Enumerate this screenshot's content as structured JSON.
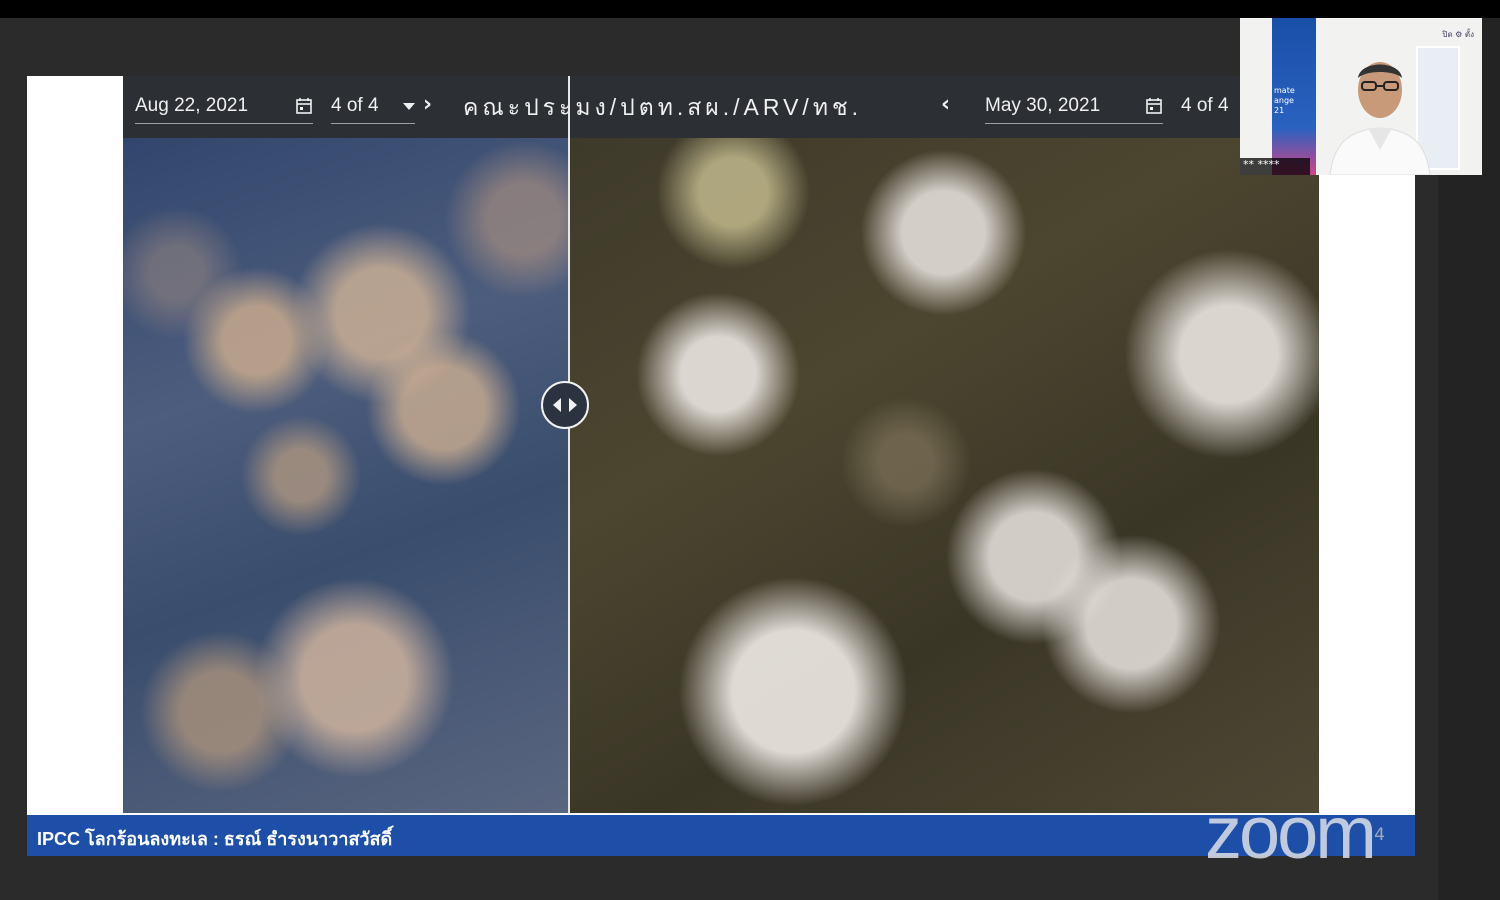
{
  "comparison": {
    "left": {
      "date": "Aug 22, 2021",
      "page": "4 of 4"
    },
    "right": {
      "date": "May 30, 2021",
      "page": "4 of 4"
    },
    "credit": "คณะประมง/ปตท.สผ./ARV/ทช."
  },
  "slide": {
    "footer_title": "IPCC โลกร้อนลงทะเล : ธรณ์ ธำรงนาวาสวัสดิ์",
    "page_number": "4"
  },
  "zoom": {
    "watermark": "zoom"
  },
  "video": {
    "participant_label": "** ****",
    "poster_lines": [
      "mate",
      "ange",
      "21"
    ],
    "side_text": "ปิด  ⚙ ตั้ง"
  },
  "colors": {
    "footer_bar": "#1e4fa8",
    "topbar": "#2c2f34"
  }
}
